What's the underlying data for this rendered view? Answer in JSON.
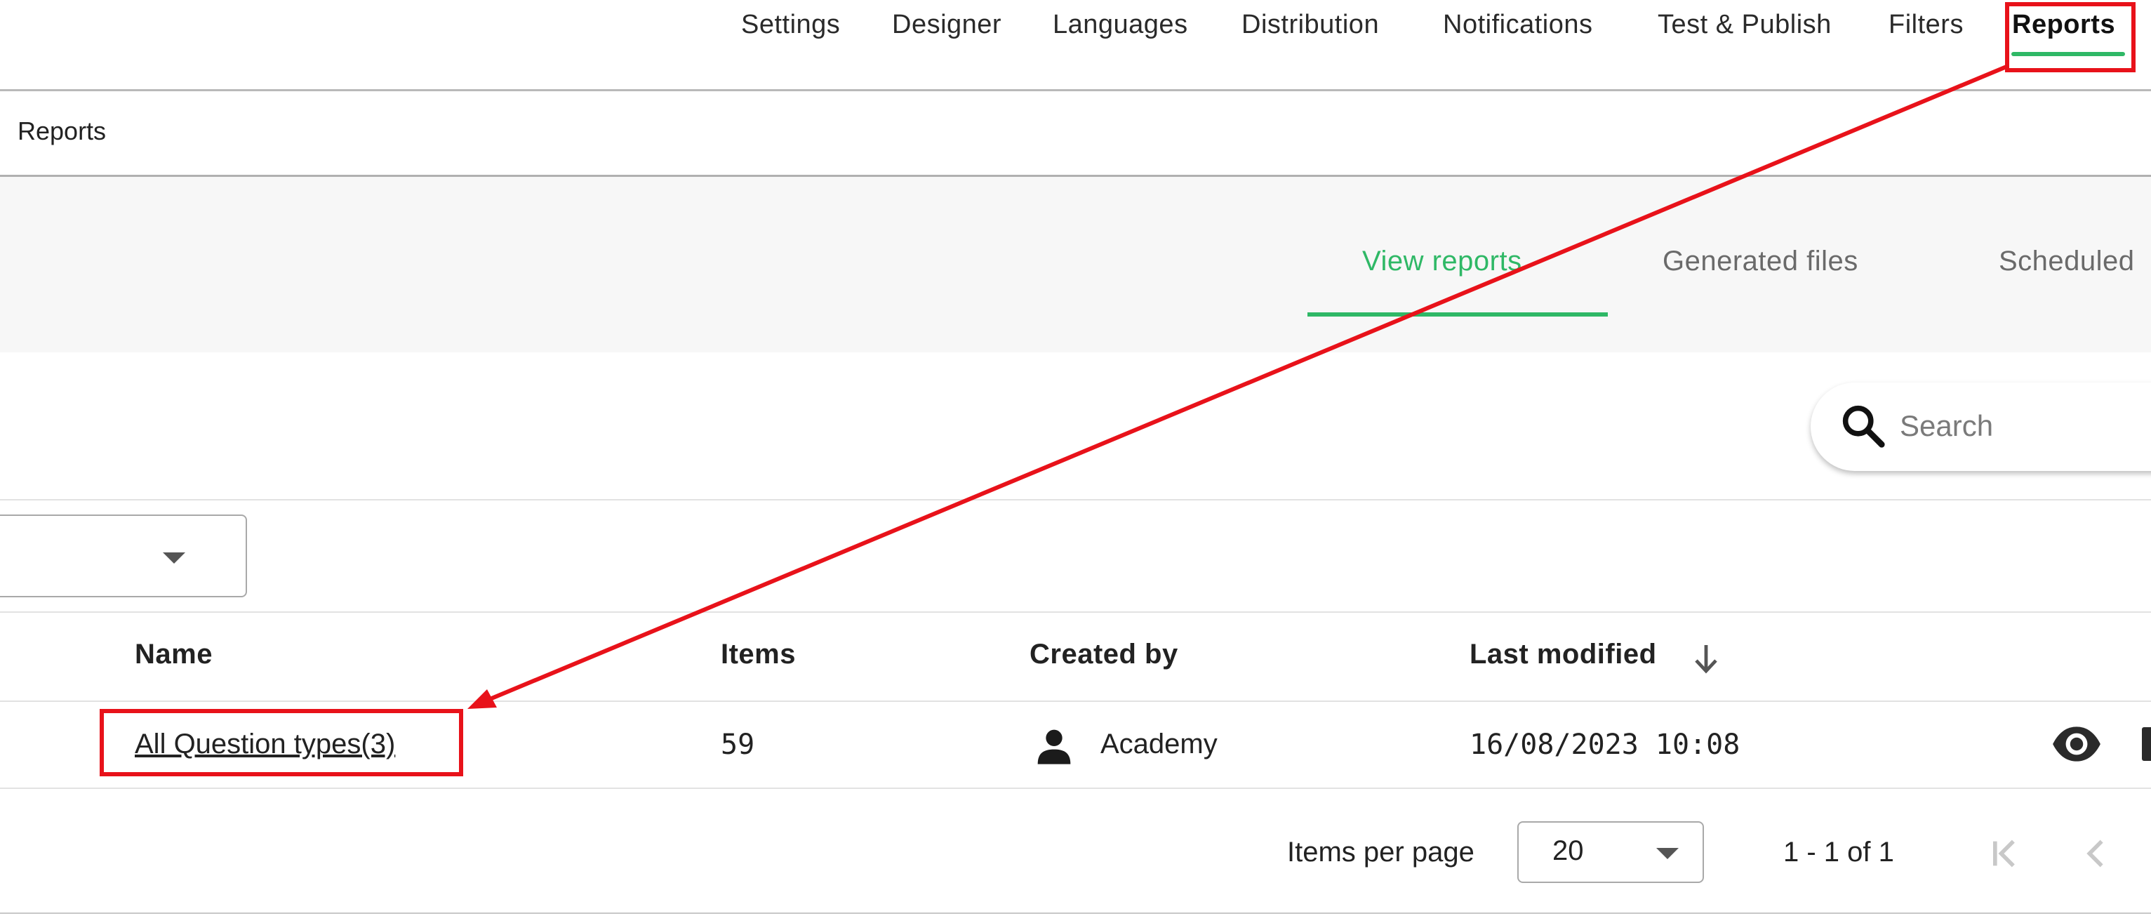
{
  "topnav": {
    "items": [
      "Settings",
      "Designer",
      "Languages",
      "Distribution",
      "Notifications",
      "Test & Publish",
      "Filters",
      "Reports"
    ],
    "active": "Reports"
  },
  "breadcrumb": {
    "current": "Reports"
  },
  "subtabs": {
    "items": [
      "View reports",
      "Generated files",
      "Scheduled"
    ],
    "active": "View reports"
  },
  "search": {
    "placeholder": "Search",
    "icon": "search-icon"
  },
  "filter": {
    "value": "",
    "icon": "chevron-down-icon"
  },
  "table": {
    "columns": {
      "name": "Name",
      "items": "Items",
      "created_by": "Created by",
      "last_modified": "Last modified"
    },
    "sort": {
      "column": "Last modified",
      "direction": "desc",
      "icon": "arrow-down-icon"
    },
    "rows": [
      {
        "name": "All Question types(3)",
        "items": "59",
        "created_by": "Academy",
        "last_modified": "16/08/2023 10:08"
      }
    ],
    "row_icons": [
      "person-icon",
      "eye-icon"
    ]
  },
  "pagination": {
    "items_per_page_label": "Items per page",
    "items_per_page_value": "20",
    "range": "1 - 1 of 1"
  },
  "colors": {
    "accent": "#2fb866",
    "annotation": "#e8121a"
  }
}
